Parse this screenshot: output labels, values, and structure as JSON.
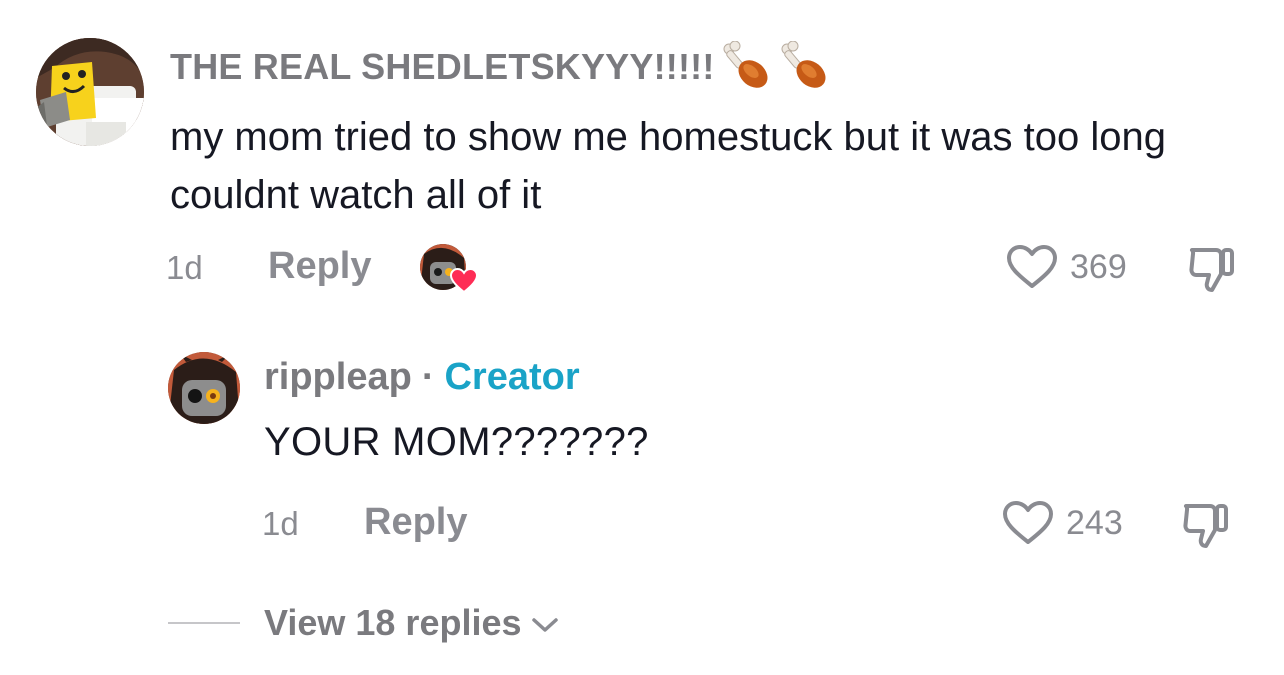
{
  "comment": {
    "username": "THE REAL SHEDLETSKYYY!!!!!",
    "username_emoji": "poultry-leg-emoji",
    "text": "my mom tried to show me homestuck but it was too long couldnt watch all of it",
    "time": "1d",
    "reply_label": "Reply",
    "like_count": "369",
    "liked_by_creator": true
  },
  "reply": {
    "username": "rippleap",
    "separator": "·",
    "badge": "Creator",
    "text": "YOUR MOM???????",
    "time": "1d",
    "reply_label": "Reply",
    "like_count": "243"
  },
  "view_replies": {
    "label": "View 18 replies"
  },
  "colors": {
    "muted_text": "#8a8b91",
    "creator_badge": "#1aa3c7",
    "like_heart": "#fe2c55",
    "body_text": "#161823"
  }
}
